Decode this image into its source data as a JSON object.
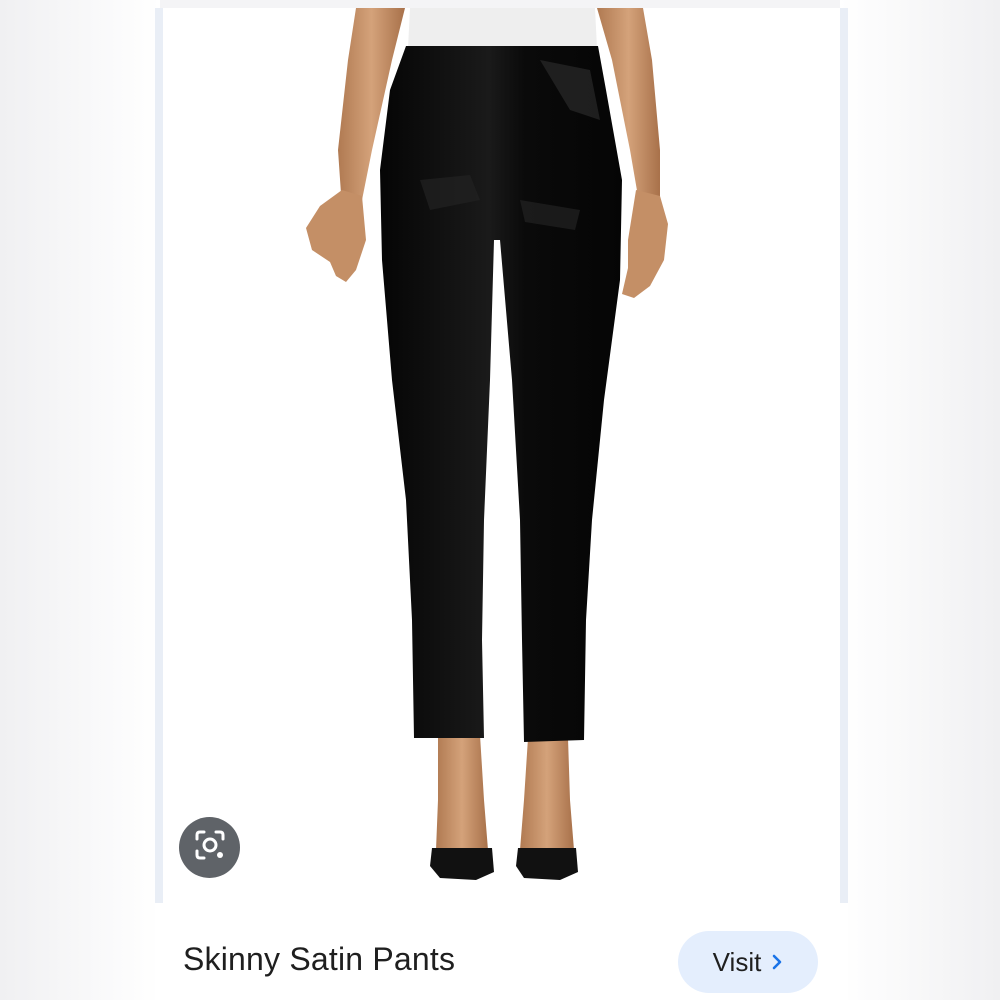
{
  "result_card": {
    "title": "Skinny Satin Pants",
    "visit_label": "Visit"
  },
  "icons": {
    "lens": "google-lens-icon",
    "chevron": "chevron-right-icon"
  },
  "colors": {
    "visit_bg": "#e4eefd",
    "lens_bg": "#5f6368",
    "chevron": "#1a73e8"
  }
}
